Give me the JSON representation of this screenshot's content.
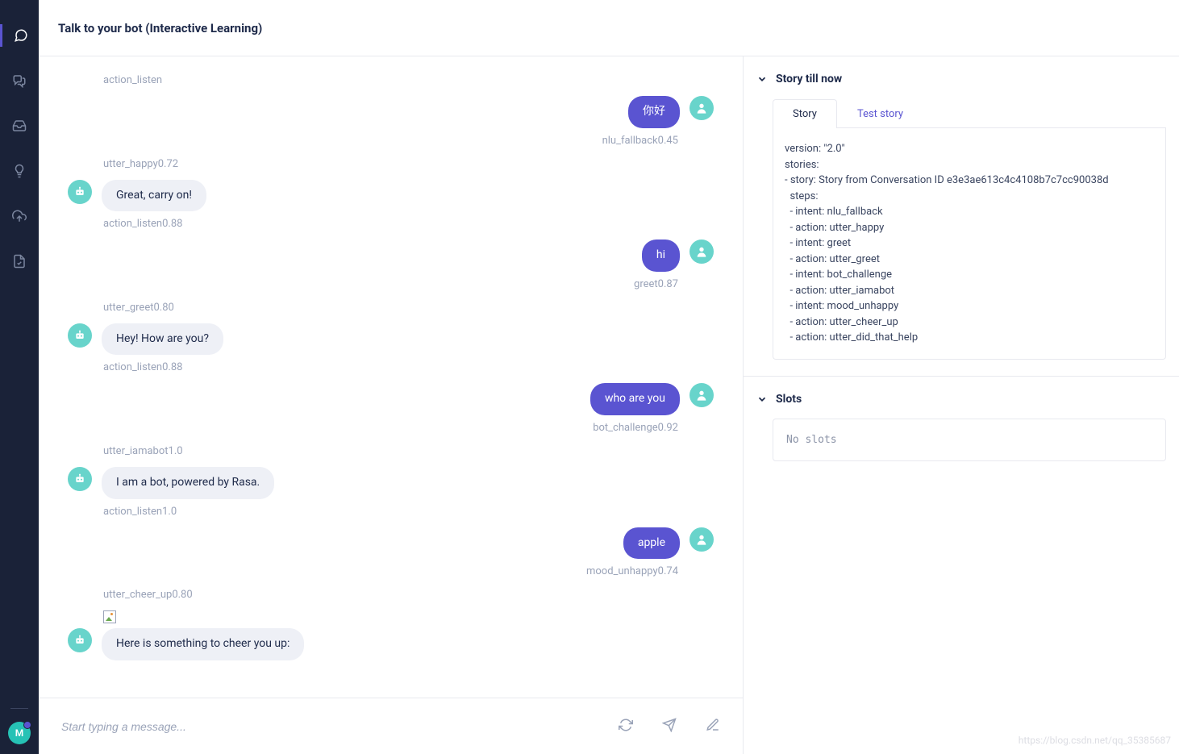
{
  "header": {
    "title": "Talk to your bot (Interactive Learning)"
  },
  "sidebar": {
    "avatar_letter": "M"
  },
  "chat": {
    "items": [
      {
        "type": "meta_bot",
        "text": "action_listen"
      },
      {
        "type": "user_msg",
        "text": "你好"
      },
      {
        "type": "meta_user",
        "text": "nlu_fallback0.45"
      },
      {
        "type": "meta_bot",
        "text": "utter_happy0.72"
      },
      {
        "type": "bot_msg",
        "text": "Great, carry on!"
      },
      {
        "type": "meta_bot",
        "text": "action_listen0.88"
      },
      {
        "type": "user_msg",
        "text": "hi"
      },
      {
        "type": "meta_user",
        "text": "greet0.87"
      },
      {
        "type": "meta_bot",
        "text": "utter_greet0.80"
      },
      {
        "type": "bot_msg",
        "text": "Hey! How are you?"
      },
      {
        "type": "meta_bot",
        "text": "action_listen0.88"
      },
      {
        "type": "user_msg",
        "text": "who are you"
      },
      {
        "type": "meta_user",
        "text": "bot_challenge0.92"
      },
      {
        "type": "meta_bot",
        "text": "utter_iamabot1.0"
      },
      {
        "type": "bot_msg",
        "text": "I am a bot, powered by Rasa."
      },
      {
        "type": "meta_bot",
        "text": "action_listen1.0"
      },
      {
        "type": "user_msg",
        "text": "apple"
      },
      {
        "type": "meta_user",
        "text": "mood_unhappy0.74"
      },
      {
        "type": "meta_bot",
        "text": "utter_cheer_up0.80"
      },
      {
        "type": "image_placeholder"
      },
      {
        "type": "bot_msg",
        "text": "Here is something to cheer you up:"
      }
    ]
  },
  "input": {
    "placeholder": "Start typing a message..."
  },
  "story_panel": {
    "title": "Story till now",
    "tabs": {
      "story": "Story",
      "test": "Test story"
    },
    "lines": [
      "version: \"2.0\"",
      "stories:",
      "- story: Story from Conversation ID e3e3ae613c4c4108b7c7cc90038d",
      "  steps:",
      "  - intent: nlu_fallback",
      "  - action: utter_happy",
      "  - intent: greet",
      "  - action: utter_greet",
      "  - intent: bot_challenge",
      "  - action: utter_iamabot",
      "  - intent: mood_unhappy",
      "  - action: utter_cheer_up",
      "  - action: utter_did_that_help"
    ]
  },
  "slots_panel": {
    "title": "Slots",
    "content": "No slots"
  },
  "watermark": "https://blog.csdn.net/qq_35385687"
}
